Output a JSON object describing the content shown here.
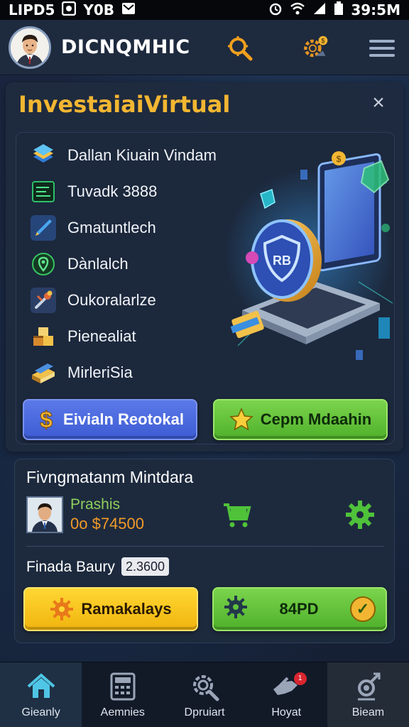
{
  "status_bar": {
    "left_text": "LIPD5",
    "carrier_text": "Y0B",
    "time": "39:5M"
  },
  "header": {
    "app_name": "DICNQMHIC"
  },
  "main_card": {
    "title": "InvestaiaiVirtual",
    "close_glyph": "×",
    "menu_items": [
      {
        "label": "Dallan Kiuain Vindam",
        "icon": "stacked-cards-icon"
      },
      {
        "label": "Tuvadk 3888",
        "icon": "terminal-screen-icon"
      },
      {
        "label": "Gmatuntlech",
        "icon": "pen-tool-icon"
      },
      {
        "label": "Dànlalch",
        "icon": "location-pin-icon"
      },
      {
        "label": "Oukoralarlze",
        "icon": "tools-icon"
      },
      {
        "label": "Pienealiat",
        "icon": "blocks-icon"
      },
      {
        "label": "MirleriSia",
        "icon": "books-icon"
      }
    ],
    "primary_button": {
      "label": "Eivialn Reotokal",
      "icon": "dollar-icon"
    },
    "secondary_button": {
      "label": "Cepm Mdaahin",
      "icon": "star-icon"
    }
  },
  "profile_card": {
    "title": "Fivngmatanm Mintdara",
    "name": "Prashis",
    "amount": "0o $74500",
    "finance_label": "Finada Baury",
    "finance_value": "2.3600",
    "yellow_button": {
      "label": "Ramakalays",
      "icon": "gear-orange-icon"
    },
    "green_button": {
      "label": "84PD",
      "icon": "gear-dark-icon",
      "check": "✓"
    }
  },
  "bottom_nav": [
    {
      "label": "Gieanly",
      "icon": "home-icon",
      "active": true
    },
    {
      "label": "Aemnies",
      "icon": "calculator-icon",
      "active": false
    },
    {
      "label": "Dpruiart",
      "icon": "magnifier-gear-icon",
      "active": false
    },
    {
      "label": "Hoyat",
      "icon": "hand-icon",
      "active": false,
      "badge": "1"
    },
    {
      "label": "Bieam",
      "icon": "settings-person-icon",
      "active": false
    }
  ],
  "colors": {
    "accent_title": "#f2b632",
    "green": "#4fb02b",
    "blue": "#3d5cd4",
    "yellow": "#f1b40e",
    "amount": "#f29a28"
  }
}
